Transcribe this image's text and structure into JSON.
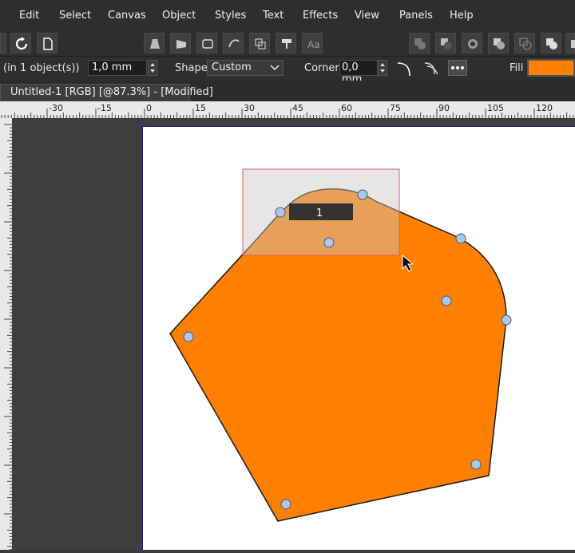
{
  "menu": [
    "Edit",
    "Select",
    "Canvas",
    "Object",
    "Styles",
    "Text",
    "Effects",
    "View",
    "Panels",
    "Help"
  ],
  "toolbar": {
    "left_icons": [
      "refresh-icon",
      "document-icon"
    ],
    "mid_icons": [
      "perspective-icon",
      "flip-icon",
      "envelope-icon",
      "arrange-icon",
      "group-icon",
      "format-brush-icon",
      "text-style-icon"
    ],
    "right_icons": [
      "boolean-add-icon",
      "boolean-subtract-icon",
      "boolean-intersect-icon",
      "boolean-exclude-icon",
      "boolean-divide-icon",
      "boolean-combine-icon",
      "boolean-extra-icon"
    ]
  },
  "props": {
    "selection_info": "(in 1 object(s))",
    "width_value": "1,0 mm",
    "shape_label": "Shape",
    "shape_value": "Custom",
    "corner_label": "Corner",
    "corner_value": "0,0 mm",
    "fill_label": "Fill",
    "fill_color": "#ff8000"
  },
  "tab": {
    "title": "Untitled-1 [RGB] [@87.3%] - [Modified]"
  },
  "ruler": {
    "labels": [
      "-30",
      "-15",
      "0",
      "15",
      "30",
      "45",
      "60",
      "75",
      "90",
      "105",
      "120"
    ]
  },
  "canvas": {
    "tooltip_value": "1",
    "shape_fill": "#ff8000",
    "node_fill": "#aec7e8"
  }
}
